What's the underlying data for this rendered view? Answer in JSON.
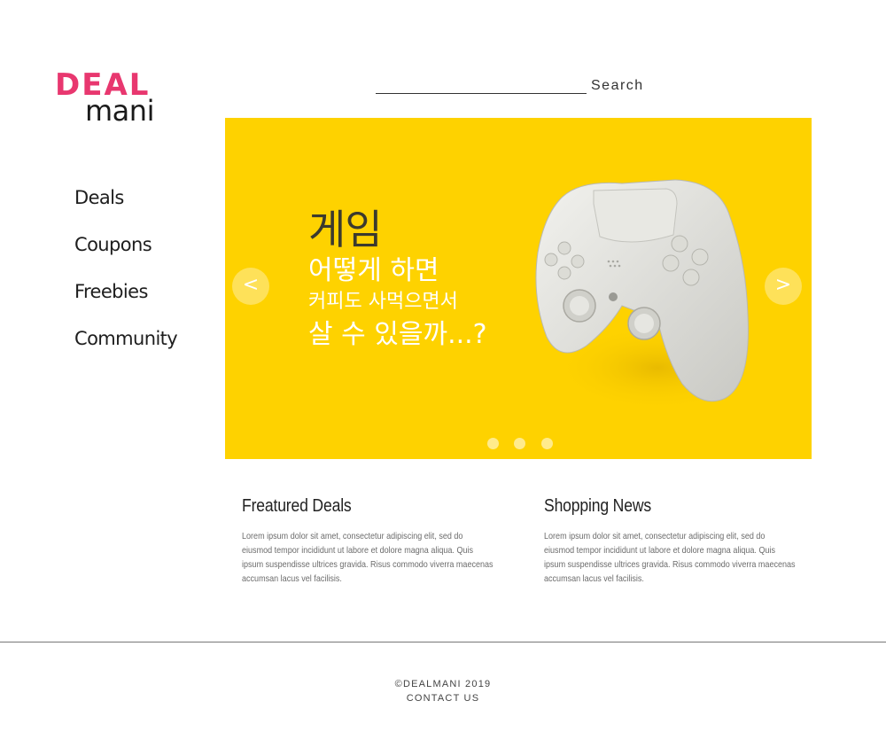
{
  "logo": {
    "top": "DEAL",
    "bottom": "mani"
  },
  "sidebar": {
    "items": [
      {
        "label": "Deals"
      },
      {
        "label": "Coupons"
      },
      {
        "label": "Freebies"
      },
      {
        "label": "Community"
      }
    ]
  },
  "search": {
    "label": "Search",
    "value": ""
  },
  "hero": {
    "background_color": "#fed200",
    "title": "게임",
    "line1": "어떻게 하면",
    "line2": "커피도 사먹으면서",
    "line3": "살 수 있을까...?",
    "prev_icon": "chevron-left-icon",
    "next_icon": "chevron-right-icon",
    "prev_glyph": "<",
    "next_glyph": ">",
    "dot_count": 3,
    "image": "game-controller-image"
  },
  "sections": {
    "featured": {
      "title": "Freatured Deals",
      "body": "Lorem ipsum dolor sit amet, consectetur adipiscing elit, sed do eiusmod tempor incididunt ut labore et dolore magna aliqua. Quis ipsum suspendisse ultrices gravida. Risus commodo viverra maecenas accumsan lacus vel facilisis."
    },
    "news": {
      "title": "Shopping News",
      "body": "Lorem ipsum dolor sit amet, consectetur adipiscing elit, sed do eiusmod tempor incididunt ut labore et dolore magna aliqua. Quis ipsum suspendisse ultrices gravida. Risus commodo viverra maecenas accumsan lacus vel facilisis."
    }
  },
  "footer": {
    "copyright": "©DEALMANI 2019",
    "contact": "CONTACT US"
  },
  "colors": {
    "brand_pink": "#e8376f",
    "banner_yellow": "#fed200"
  }
}
